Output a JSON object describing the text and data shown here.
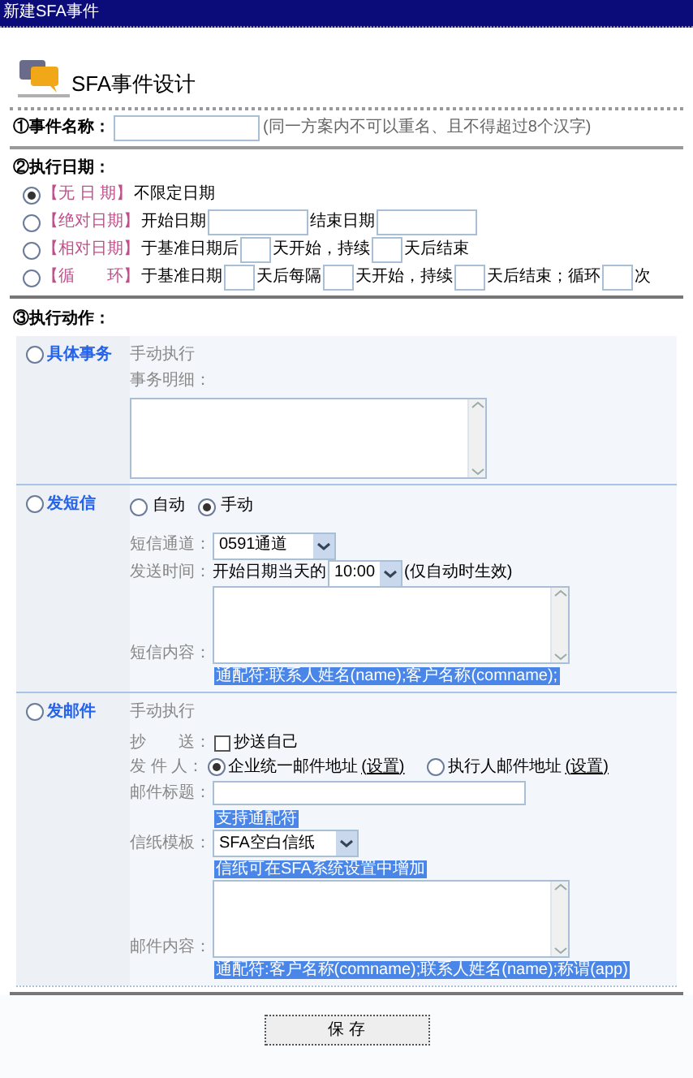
{
  "window": {
    "title": "新建SFA事件"
  },
  "heading": "SFA事件设计",
  "event_name": {
    "label": "①事件名称：",
    "hint": "(同一方案内不可以重名、且不得超过8个汉字)"
  },
  "schedule": {
    "label": "②执行日期：",
    "options": [
      {
        "tag": "【无 日 期】",
        "selected": true,
        "parts": [
          {
            "kind": "text",
            "text": "不限定日期"
          }
        ]
      },
      {
        "tag": "【绝对日期】",
        "selected": false,
        "parts": [
          {
            "kind": "text",
            "text": "开始日期"
          },
          {
            "kind": "wide"
          },
          {
            "kind": "text",
            "text": "结束日期"
          },
          {
            "kind": "wide"
          }
        ]
      },
      {
        "tag": "【相对日期】",
        "selected": false,
        "parts": [
          {
            "kind": "text",
            "text": "于基准日期后"
          },
          {
            "kind": "field"
          },
          {
            "kind": "text",
            "text": "天开始，持续"
          },
          {
            "kind": "field"
          },
          {
            "kind": "text",
            "text": "天后结束"
          }
        ]
      },
      {
        "tag": "【循　　环】",
        "selected": false,
        "parts": [
          {
            "kind": "text",
            "text": "于基准日期"
          },
          {
            "kind": "field"
          },
          {
            "kind": "text",
            "text": "天后每隔"
          },
          {
            "kind": "field"
          },
          {
            "kind": "text",
            "text": "天开始，持续"
          },
          {
            "kind": "field"
          },
          {
            "kind": "text",
            "text": "天后结束；循环"
          },
          {
            "kind": "field"
          },
          {
            "kind": "text",
            "text": "次"
          }
        ]
      }
    ]
  },
  "actions": {
    "label": "③执行动作：",
    "items": [
      {
        "kind": "task",
        "label": "具体事务",
        "selected": false,
        "mode": "手动执行",
        "detail_label": "事务明细："
      },
      {
        "kind": "sms",
        "label": "发短信",
        "selected": false,
        "modes": [
          {
            "label": "自动",
            "selected": false
          },
          {
            "label": "手动",
            "selected": true
          }
        ],
        "channel_label": "短信通道：",
        "channel_value": "0591通道",
        "time_label": "发送时间：",
        "time_prefix": "开始日期当天的",
        "time_value": "10:00",
        "time_note": "(仅自动时生效)",
        "content_label": "短信内容：",
        "content_hint": "通配符:联系人姓名(name);客户名称(comname);"
      },
      {
        "kind": "mail",
        "label": "发邮件",
        "selected": false,
        "mode": "手动执行",
        "cc_label": "抄　　送：",
        "cc_option": {
          "label": "抄送自己",
          "checked": false
        },
        "sender_label": "发 件 人：",
        "senders": [
          {
            "label": "企业统一邮件地址",
            "link": "(设置)",
            "selected": true
          },
          {
            "label": "执行人邮件地址",
            "link": "(设置)",
            "selected": false
          }
        ],
        "subject_label": "邮件标题：",
        "subject_hint": "支持通配符",
        "template_label": "信纸模板：",
        "template_value": "SFA空白信纸",
        "template_hint": "信纸可在SFA系统设置中增加",
        "content_label": "邮件内容：",
        "content_hint": "通配符:客户名称(comname);联系人姓名(name);称谓(app)"
      }
    ]
  },
  "save_button": "保 存"
}
